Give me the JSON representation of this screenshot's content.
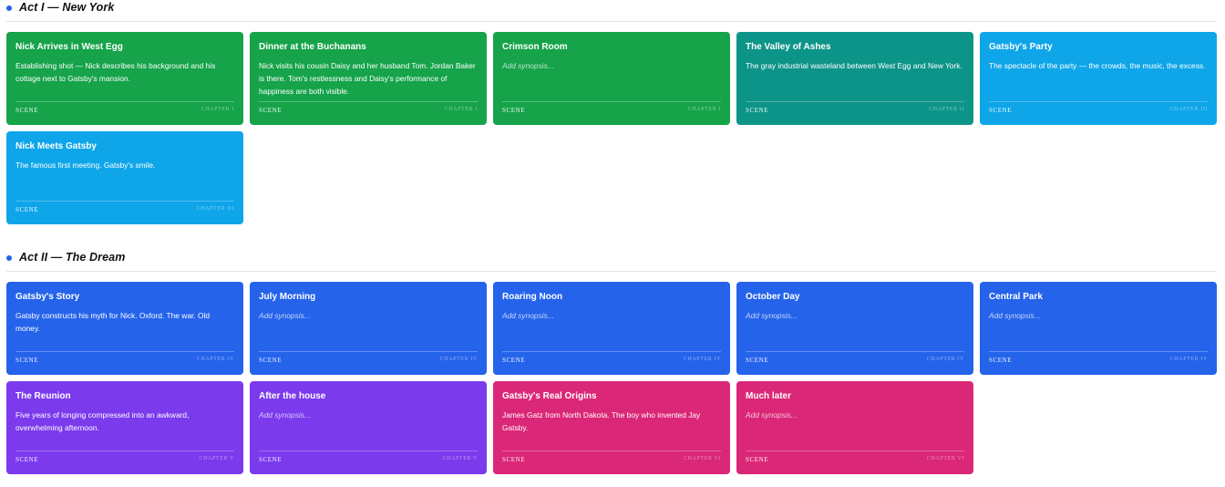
{
  "acts": [
    {
      "title": "Act I — New York",
      "cards": [
        {
          "title": "Nick Arrives in West Egg",
          "synopsis": "Establishing shot — Nick describes his background and his cottage next to Gatsby's mansion.",
          "type": "SCENE",
          "chapter": "CHAPTER I",
          "color": "#16a34a"
        },
        {
          "title": "Dinner at the Buchanans",
          "synopsis": "Nick visits his cousin Daisy and her husband Tom. Jordan Baker is there. Tom's restlessness and Daisy's performance of happiness are both visible.",
          "type": "SCENE",
          "chapter": "CHAPTER I",
          "color": "#16a34a"
        },
        {
          "title": "Crimson Room",
          "synopsis": "",
          "placeholder": "Add synopsis...",
          "type": "SCENE",
          "chapter": "CHAPTER I",
          "color": "#16a34a"
        },
        {
          "title": "The Valley of Ashes",
          "synopsis": "The gray industrial wasteland between West Egg and New York.",
          "type": "SCENE",
          "chapter": "CHAPTER II",
          "color": "#0d9488"
        },
        {
          "title": "Gatsby's Party",
          "synopsis": "The spectacle of the party — the crowds, the music, the excess.",
          "type": "SCENE",
          "chapter": "CHAPTER III",
          "color": "#0ea5e9"
        },
        {
          "title": "Nick Meets Gatsby",
          "synopsis": "The famous first meeting. Gatsby's smile.",
          "type": "SCENE",
          "chapter": "CHAPTER III",
          "color": "#0ea5e9"
        }
      ]
    },
    {
      "title": "Act II — The Dream",
      "cards": [
        {
          "title": "Gatsby's Story",
          "synopsis": "Gatsby constructs his myth for Nick. Oxford. The war. Old money.",
          "type": "SCENE",
          "chapter": "CHAPTER IV",
          "color": "#2563eb"
        },
        {
          "title": "July Morning",
          "synopsis": "",
          "placeholder": "Add synopsis...",
          "type": "SCENE",
          "chapter": "CHAPTER IV",
          "color": "#2563eb"
        },
        {
          "title": "Roaring Noon",
          "synopsis": "",
          "placeholder": "Add synopsis...",
          "type": "SCENE",
          "chapter": "CHAPTER IV",
          "color": "#2563eb"
        },
        {
          "title": "October Day",
          "synopsis": "",
          "placeholder": "Add synopsis...",
          "type": "SCENE",
          "chapter": "CHAPTER IV",
          "color": "#2563eb"
        },
        {
          "title": "Central Park",
          "synopsis": "",
          "placeholder": "Add synopsis...",
          "type": "SCENE",
          "chapter": "CHAPTER IV",
          "color": "#2563eb"
        },
        {
          "title": "The Reunion",
          "synopsis": "Five years of longing compressed into an awkward, overwhelming afternoon.",
          "type": "SCENE",
          "chapter": "CHAPTER V",
          "color": "#7c3aed"
        },
        {
          "title": "After the house",
          "synopsis": "",
          "placeholder": "Add synopsis...",
          "type": "SCENE",
          "chapter": "CHAPTER V",
          "color": "#7c3aed"
        },
        {
          "title": "Gatsby's Real Origins",
          "synopsis": "James Gatz from North Dakota. The boy who invented Jay Gatsby.",
          "type": "SCENE",
          "chapter": "CHAPTER VI",
          "color": "#db2777"
        },
        {
          "title": "Much later",
          "synopsis": "",
          "placeholder": "Add synopsis...",
          "type": "SCENE",
          "chapter": "CHAPTER VI",
          "color": "#db2777"
        }
      ]
    }
  ]
}
